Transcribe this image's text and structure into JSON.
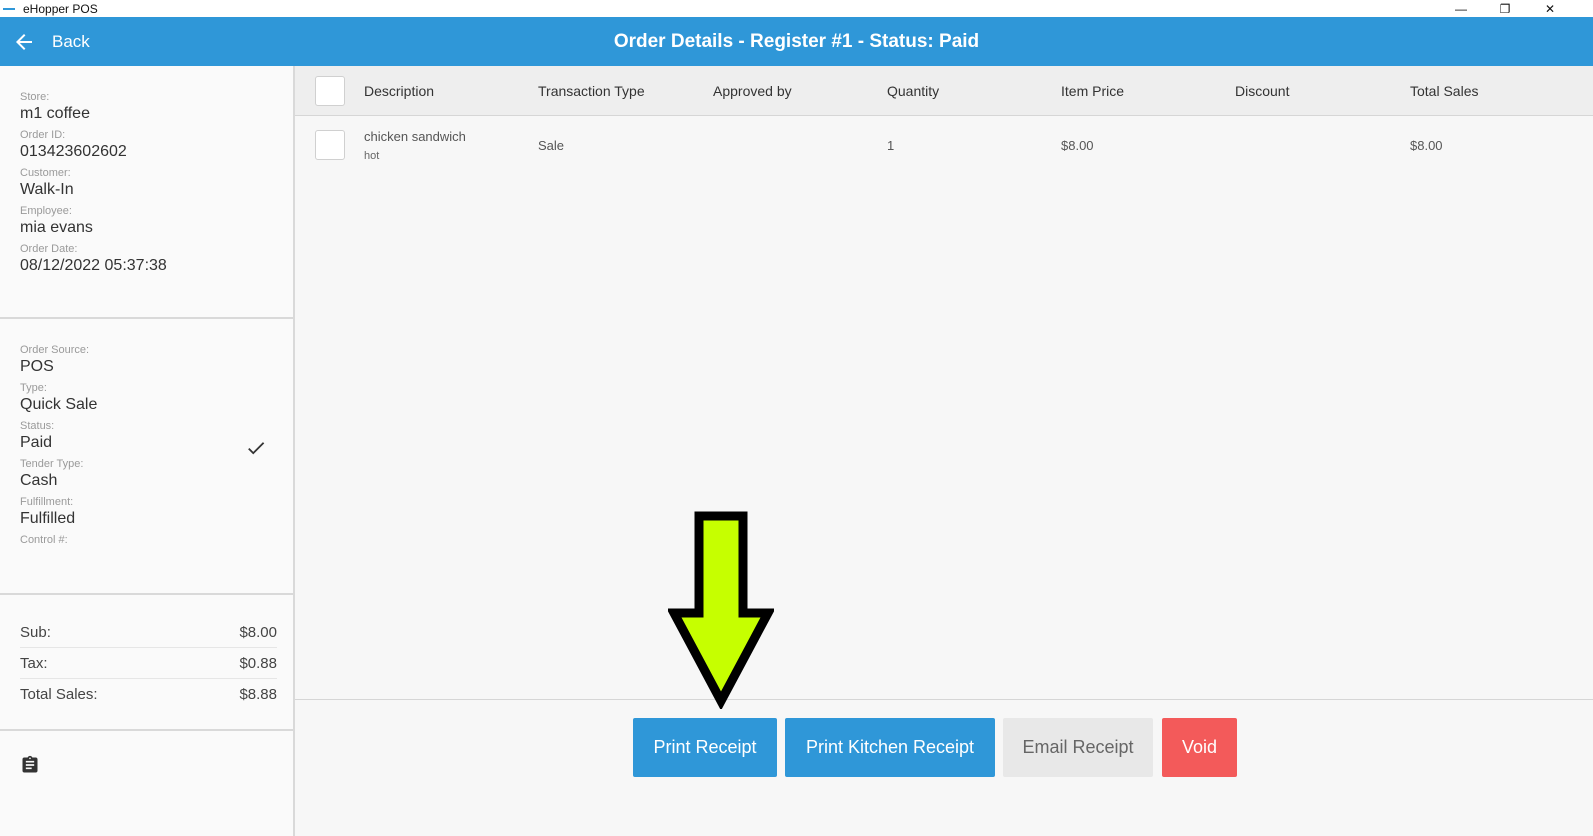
{
  "os": {
    "title": "eHopper POS",
    "minimize": "—",
    "maximize": "❐",
    "close": "✕"
  },
  "header": {
    "back_label": "Back",
    "title": "Order Details - Register #1 - Status: Paid",
    "color": "#2f97d8"
  },
  "sidebar": {
    "order_info": [
      {
        "label": "Store:",
        "value": "m1 coffee"
      },
      {
        "label": "Order ID:",
        "value": "013423602602"
      },
      {
        "label": "Customer:",
        "value": "Walk-In"
      },
      {
        "label": "Employee:",
        "value": "mia evans"
      },
      {
        "label": "Order Date:",
        "value": "08/12/2022 05:37:38"
      }
    ],
    "order_meta": [
      {
        "label": "Order Source:",
        "value": "POS"
      },
      {
        "label": "Type:",
        "value": "Quick Sale"
      },
      {
        "label": "Status:",
        "value": "Paid"
      },
      {
        "label": "Tender Type:",
        "value": "Cash"
      },
      {
        "label": "Fulfillment:",
        "value": "Fulfilled"
      },
      {
        "label": "Control #:",
        "value": ""
      }
    ],
    "totals": [
      {
        "label": "Sub:",
        "value": "$8.00"
      },
      {
        "label": "Tax:",
        "value": "$0.88"
      },
      {
        "label": "Total Sales:",
        "value": "$8.88"
      }
    ]
  },
  "table": {
    "columns": [
      "Description",
      "Transaction Type",
      "Approved by",
      "Quantity",
      "Item Price",
      "Discount",
      "Total Sales"
    ],
    "rows": [
      {
        "description": "chicken sandwich",
        "modifier": "hot",
        "transaction_type": "Sale",
        "approved_by": "",
        "quantity": "1",
        "item_price": "$8.00",
        "discount": "",
        "total_sales": "$8.00"
      }
    ]
  },
  "actions": {
    "print_receipt": "Print Receipt",
    "print_kitchen_receipt": "Print Kitchen Receipt",
    "email_receipt": "Email Receipt",
    "void": "Void"
  },
  "annotation": {
    "arrow_fill": "#c6ff00",
    "arrow_stroke": "#000000"
  }
}
